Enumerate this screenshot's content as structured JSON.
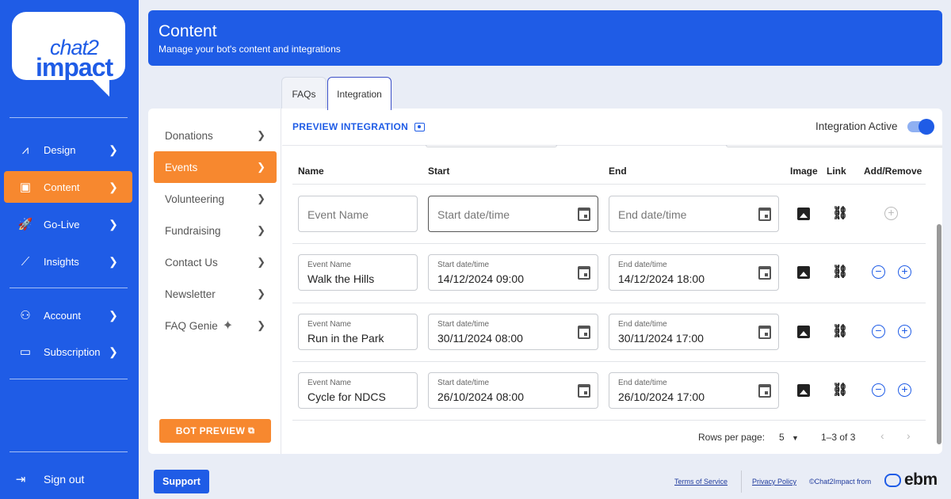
{
  "brand": {
    "line1": "chat2",
    "line2": "impact"
  },
  "sidebar": {
    "items": [
      {
        "label": "Design",
        "icon": "compass-icon"
      },
      {
        "label": "Content",
        "icon": "content-icon",
        "active": true
      },
      {
        "label": "Go-Live",
        "icon": "rocket-icon"
      },
      {
        "label": "Insights",
        "icon": "insights-icon"
      },
      {
        "label": "Account",
        "icon": "person-icon"
      },
      {
        "label": "Subscription",
        "icon": "card-icon"
      }
    ],
    "signout": "Sign out"
  },
  "header": {
    "title": "Content",
    "subtitle": "Manage your bot's content and integrations"
  },
  "tabs": [
    "FAQs",
    "Integration"
  ],
  "subnav": {
    "items": [
      "Donations",
      "Events",
      "Volunteering",
      "Fundraising",
      "Contact Us",
      "Newsletter",
      "FAQ Genie"
    ],
    "active": "Events",
    "bot_preview": "BOT PREVIEW"
  },
  "integration": {
    "preview_label": "PREVIEW INTEGRATION",
    "active_label": "Integration Active",
    "active": true
  },
  "table": {
    "columns": [
      "Name",
      "Start",
      "End",
      "Image",
      "Link",
      "Add/Remove"
    ],
    "new_row": {
      "name_placeholder": "Event Name",
      "start_placeholder": "Start date/time",
      "end_placeholder": "End date/time"
    },
    "field_labels": {
      "name": "Event Name",
      "start": "Start date/time",
      "end": "End date/time"
    },
    "rows": [
      {
        "name": "Walk the Hills",
        "start": "14/12/2024 09:00",
        "end": "14/12/2024 18:00"
      },
      {
        "name": "Run in the Park",
        "start": "30/11/2024 08:00",
        "end": "30/11/2024 17:00"
      },
      {
        "name": "Cycle for NDCS",
        "start": "26/10/2024 08:00",
        "end": "26/10/2024 17:00"
      }
    ]
  },
  "pagination": {
    "rows_label": "Rows per page:",
    "rows_value": "5",
    "range": "1–3 of 3"
  },
  "footer": {
    "support": "Support",
    "terms": "Terms of Service",
    "privacy": "Privacy Policy",
    "copyright": "©Chat2Impact from",
    "ebm": "ebm"
  },
  "colors": {
    "primary": "#1f5ce6",
    "accent": "#f7882f"
  }
}
